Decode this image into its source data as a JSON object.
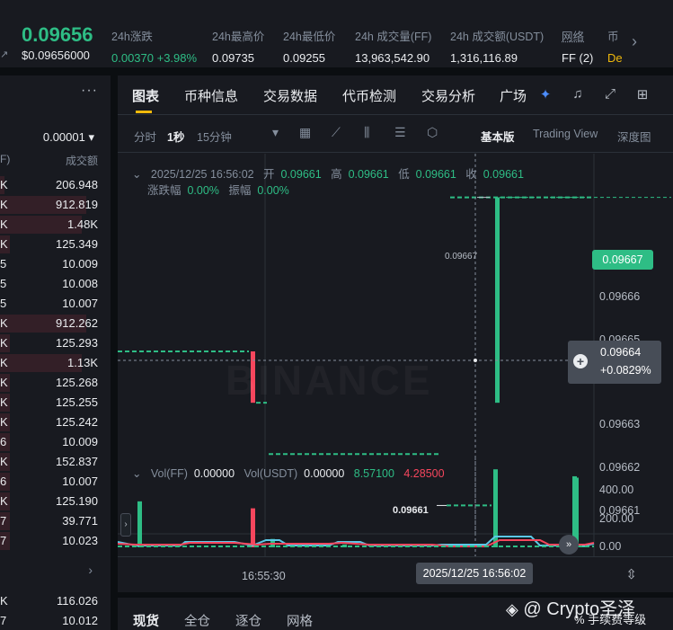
{
  "header": {
    "last_price": "0.09656",
    "last_price_usd": "$0.09656000",
    "stats": [
      {
        "label": "24h涨跌",
        "value": "0.00370 +3.98%"
      },
      {
        "label": "24h最高价",
        "value": "0.09735"
      },
      {
        "label": "24h最低价",
        "value": "0.09255"
      },
      {
        "label": "24h 成交量(FF)",
        "value": "13,963,542.90"
      },
      {
        "label": "24h 成交额(USDT)",
        "value": "1,316,116.89"
      },
      {
        "label": "网络",
        "value": "FF (2)"
      },
      {
        "label": "币",
        "value": "De"
      }
    ]
  },
  "orderbook": {
    "step": "0.00001",
    "col_left": "F)",
    "col_right": "成交额",
    "rows": [
      {
        "k": "K",
        "v": "206.948",
        "fill": 0.05
      },
      {
        "k": "K",
        "v": "912.819",
        "fill": 0.9
      },
      {
        "k": "K",
        "v": "1.48K",
        "fill": 0.85
      },
      {
        "k": "K",
        "v": "125.349",
        "fill": 0.1
      },
      {
        "k": "5",
        "v": "10.009",
        "fill": 0.0
      },
      {
        "k": "5",
        "v": "10.008",
        "fill": 0.0
      },
      {
        "k": "5",
        "v": "10.007",
        "fill": 0.0
      },
      {
        "k": "K",
        "v": "912.262",
        "fill": 0.9
      },
      {
        "k": "K",
        "v": "125.293",
        "fill": 0.1
      },
      {
        "k": "K",
        "v": "1.13K",
        "fill": 0.85
      },
      {
        "k": "K",
        "v": "125.268",
        "fill": 0.1
      },
      {
        "k": "K",
        "v": "125.255",
        "fill": 0.1
      },
      {
        "k": "K",
        "v": "125.242",
        "fill": 0.1
      },
      {
        "k": "6",
        "v": "10.009",
        "fill": 0.1
      },
      {
        "k": "K",
        "v": "152.837",
        "fill": 0.1
      },
      {
        "k": "6",
        "v": "10.007",
        "fill": 0.1
      },
      {
        "k": "K",
        "v": "125.190",
        "fill": 0.1
      },
      {
        "k": "7",
        "v": "39.771",
        "fill": 0.1
      },
      {
        "k": "7",
        "v": "10.023",
        "fill": 0.1
      }
    ],
    "rows_bottom": [
      {
        "k": "K",
        "v": "116.026"
      },
      {
        "k": "7",
        "v": "10.012"
      }
    ]
  },
  "tabs": [
    "图表",
    "币种信息",
    "交易数据",
    "代币检测",
    "交易分析",
    "广场"
  ],
  "toolbar": {
    "interval_time": "分时",
    "interval_1s": "1秒",
    "interval_15m": "15分钟",
    "view_basic": "基本版",
    "view_tv": "Trading View",
    "view_depth": "深度图"
  },
  "ohlc": {
    "datetime": "2025/12/25 16:56:02",
    "open_label": "开",
    "open": "0.09661",
    "high_label": "高",
    "high": "0.09661",
    "low_label": "低",
    "low": "0.09661",
    "close_label": "收",
    "close": "0.09661",
    "change_label": "涨跌幅",
    "change": "0.00%",
    "amp_label": "振幅",
    "amp": "0.00%"
  },
  "chart": {
    "watermark": "BINANCE",
    "y_ticks": [
      "0.09666",
      "0.09665",
      "0.09664",
      "0.09663",
      "0.09662",
      "0.09661"
    ],
    "current_price": "0.09667",
    "cross_price": "0.09664",
    "cross_change": "+0.0829%",
    "high_marker": "0.09667",
    "low_marker": "0.09661",
    "x_label": "16:55:30",
    "x_cross": "2025/12/25 16:56:02"
  },
  "chart_data": {
    "type": "line",
    "title": "",
    "ylim": [
      0.096605,
      0.096675
    ],
    "price_segments": [
      {
        "y": 0.09664,
        "color": "green",
        "style": "dashed"
      },
      {
        "y": 0.09663,
        "color": "green",
        "style": "dashed"
      },
      {
        "y": 0.09662,
        "color": "green",
        "style": "dashed"
      },
      {
        "y": 0.09661,
        "color": "green",
        "style": "dashed"
      },
      {
        "y": 0.09667,
        "color": "green",
        "style": "dashed"
      }
    ],
    "candles": [
      {
        "open": 0.09664,
        "close": 0.09663,
        "color": "red"
      },
      {
        "open": 0.09663,
        "close": 0.09667,
        "color": "green"
      }
    ],
    "volume": {
      "legend_ff_label": "Vol(FF)",
      "legend_ff": "0.00000",
      "legend_usdt_label": "Vol(USDT)",
      "legend_usdt": "0.00000",
      "ma1": "8.57100",
      "ma2": "4.28500",
      "y_ticks": [
        "400.00",
        "200.00",
        "0.00"
      ],
      "bars": [
        {
          "value": 330,
          "color": "green"
        },
        {
          "value": 280,
          "color": "red"
        },
        {
          "value": 60,
          "color": "green"
        },
        {
          "value": 20,
          "color": "green"
        },
        {
          "value": 20,
          "color": "green"
        },
        {
          "value": 560,
          "color": "green"
        },
        {
          "value": 510,
          "color": "green"
        },
        {
          "value": 500,
          "color": "green"
        },
        {
          "value": 10,
          "color": "green"
        }
      ]
    }
  },
  "bottom_tabs": [
    "现货",
    "全仓",
    "逐仓",
    "网格"
  ],
  "bottom_right": "% 手续费等级",
  "credit": "@ Crypto圣泽"
}
